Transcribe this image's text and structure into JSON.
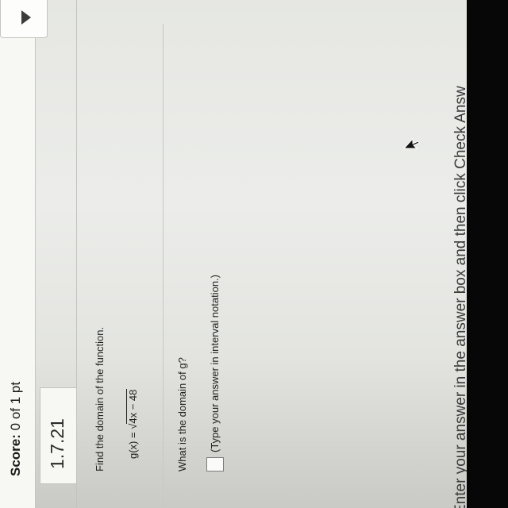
{
  "header": {
    "score_label": "Score:",
    "score_value": "0 of 1 pt"
  },
  "question": {
    "number": "1.7.21",
    "instruction": "Find the domain of the function.",
    "function_prefix": "g(x) = ",
    "radical_symbol": "√",
    "radicand": "4x − 48",
    "prompt": "What is the domain of g?",
    "answer_value": "",
    "answer_note": "(Type your answer in interval notation.)"
  },
  "footer": {
    "instruction": "Enter your answer in the answer box and then click Check Answ"
  },
  "icons": {
    "dropdown": "chevron-down-icon",
    "cursor": "mouse-pointer-icon"
  },
  "colors": {
    "page_background": "#e6e7e3",
    "bezel": "#070707"
  }
}
